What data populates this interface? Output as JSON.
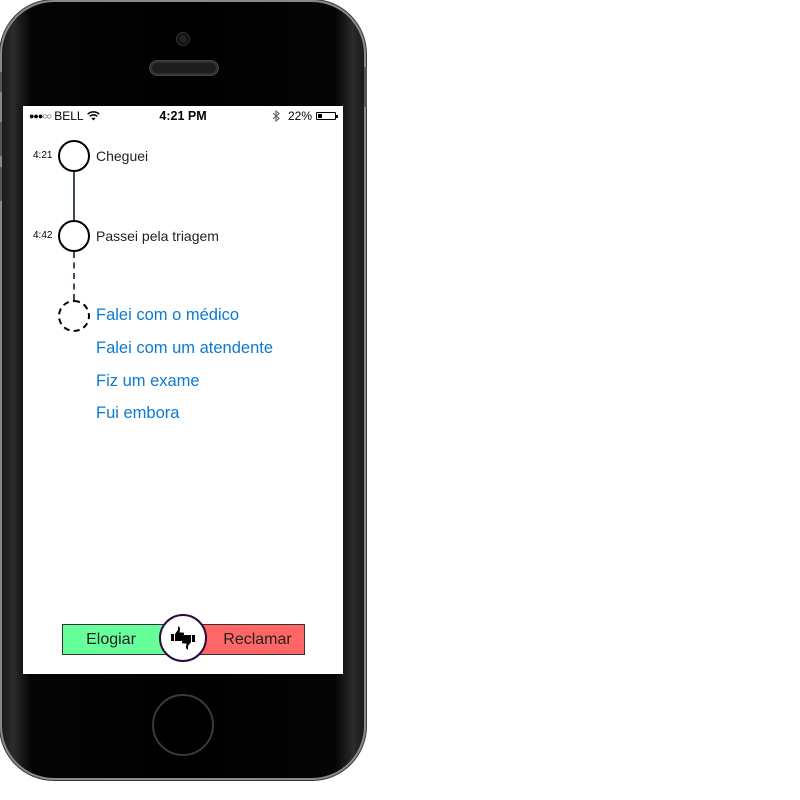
{
  "status_bar": {
    "signal": "●●●○○",
    "carrier": "BELL",
    "time": "4:21 PM",
    "battery_percent": "22%",
    "battery_level": 0.22
  },
  "timeline": {
    "events": [
      {
        "time": "4:21",
        "label": "Cheguei"
      },
      {
        "time": "4:42",
        "label": "Passei pela triagem"
      }
    ],
    "options": [
      "Falei com o médico",
      "Falei com um atendente",
      "Fiz um exame",
      "Fui embora"
    ]
  },
  "feedback": {
    "praise_label": "Elogiar",
    "complain_label": "Reclamar",
    "icon": "thumbs-up-down-icon"
  },
  "colors": {
    "praise": "#66ff99",
    "complain": "#ff6666",
    "link": "#0b7ad1"
  }
}
